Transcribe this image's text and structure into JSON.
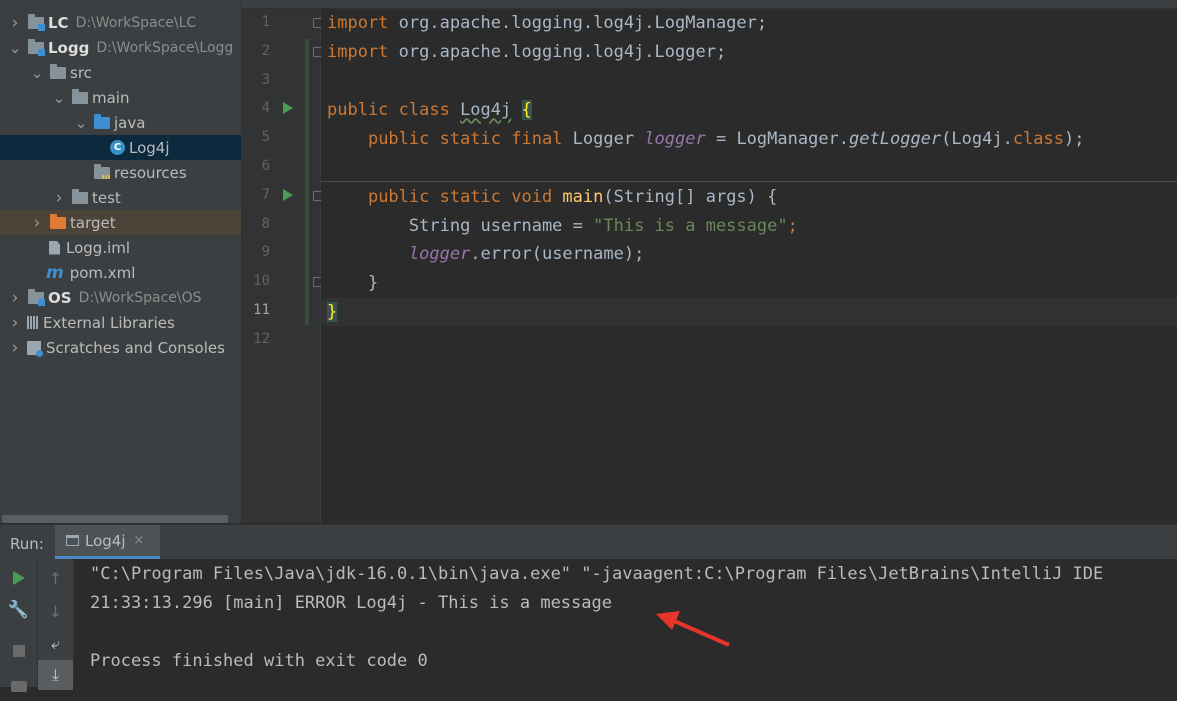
{
  "project_tree": [
    {
      "name": "LC",
      "path": "D:\\WorkSpace\\LC",
      "bold": true,
      "indent": 0,
      "arrow": "right",
      "icon": "module-folder"
    },
    {
      "name": "Logg",
      "path": "D:\\WorkSpace\\Logg",
      "bold": true,
      "indent": 0,
      "arrow": "down",
      "icon": "module-folder"
    },
    {
      "name": "src",
      "indent": 1,
      "arrow": "down",
      "icon": "folder"
    },
    {
      "name": "main",
      "indent": 2,
      "arrow": "down",
      "icon": "folder"
    },
    {
      "name": "java",
      "indent": 3,
      "arrow": "down",
      "icon": "source-folder"
    },
    {
      "name": "Log4j",
      "indent": 4,
      "arrow": "none",
      "icon": "java-class",
      "selected": true
    },
    {
      "name": "resources",
      "indent": 3,
      "arrow": "none",
      "icon": "resources-folder"
    },
    {
      "name": "test",
      "indent": 2,
      "arrow": "right",
      "icon": "folder"
    },
    {
      "name": "target",
      "indent": 1,
      "arrow": "right",
      "icon": "excluded-folder",
      "excluded": true
    },
    {
      "name": "Logg.iml",
      "indent": 1,
      "arrow": "none",
      "icon": "iml-file"
    },
    {
      "name": "pom.xml",
      "indent": 1,
      "arrow": "none",
      "icon": "maven-file"
    },
    {
      "name": "OS",
      "path": "D:\\WorkSpace\\OS",
      "bold": true,
      "indent": 0,
      "arrow": "right",
      "icon": "module-folder"
    },
    {
      "name": "External Libraries",
      "indent": 0,
      "arrow": "right",
      "icon": "libraries"
    },
    {
      "name": "Scratches and Consoles",
      "indent": 0,
      "arrow": "right",
      "icon": "scratches"
    }
  ],
  "editor": {
    "line_numbers": [
      "1",
      "2",
      "3",
      "4",
      "5",
      "6",
      "7",
      "8",
      "9",
      "10",
      "11",
      "12"
    ],
    "current_line": 11,
    "code": {
      "l1_kw": "import",
      "l1_rest": " org.apache.logging.log4j.LogManager;",
      "l2_kw": "import",
      "l2_rest": " org.apache.logging.log4j.Logger;",
      "l4_kw": "public class ",
      "l4_name": "Log4j",
      "l4_brace": "{",
      "l5_indent": "    ",
      "l5_kw": "public static final ",
      "l5_type": "Logger ",
      "l5_field": "logger",
      "l5_eq": " = LogManager.",
      "l5_call": "getLogger",
      "l5_args": "(Log4j.",
      "l5_kw2": "class",
      "l5_end": ");",
      "l7_indent": "    ",
      "l7_kw": "public static void ",
      "l7_fn": "main",
      "l7_rest": "(String[] args) {",
      "l8_indent": "        ",
      "l8_type": "String username = ",
      "l8_str": "\"This is a message\"",
      "l8_end": ";",
      "l9_indent": "        ",
      "l9_field": "logger",
      "l9_rest": ".error(username);",
      "l10": "    }",
      "l11": "}"
    }
  },
  "run_panel": {
    "label": "Run:",
    "tab_label": "Log4j",
    "tab_close": "×",
    "console_lines": [
      "\"C:\\Program Files\\Java\\jdk-16.0.1\\bin\\java.exe\" \"-javaagent:C:\\Program Files\\JetBrains\\IntelliJ IDE",
      "21:33:13.296 [main] ERROR Log4j - This is a message",
      "",
      "Process finished with exit code 0"
    ]
  },
  "colors": {
    "annotation_arrow": "#e8352b",
    "run_green": "#499c54",
    "keyword": "#cc7832",
    "string": "#6a8759",
    "field": "#9876aa"
  }
}
